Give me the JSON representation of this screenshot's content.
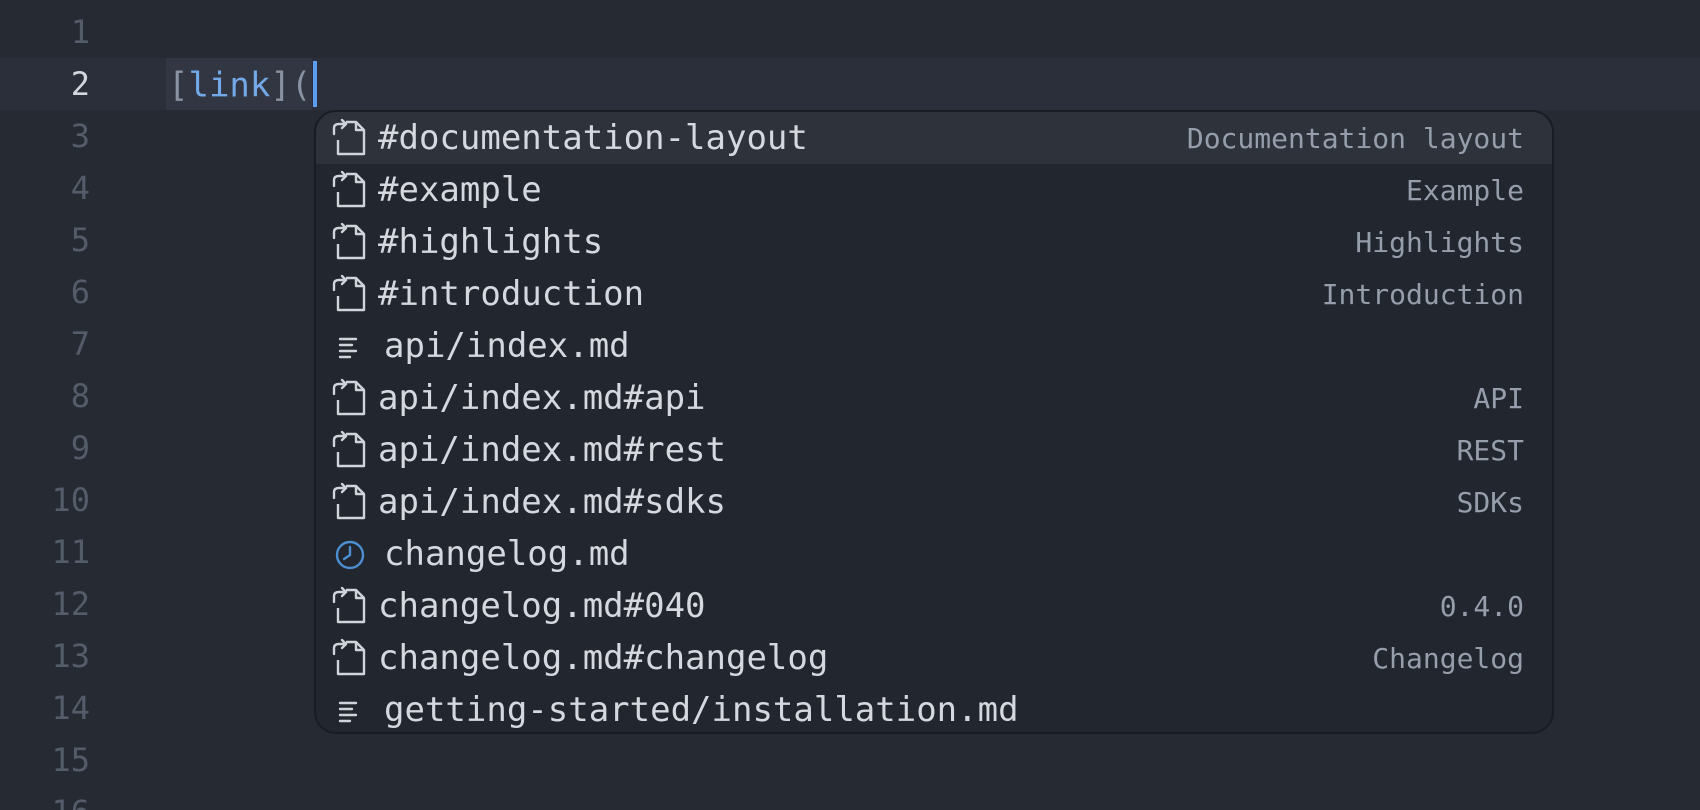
{
  "editor": {
    "line_numbers": [
      "1",
      "2",
      "3",
      "4",
      "5",
      "6",
      "7",
      "8",
      "9",
      "10",
      "11",
      "12",
      "13",
      "14",
      "15",
      "16"
    ],
    "current_line": 2,
    "line2": {
      "open_bracket": "[",
      "link_text": "link",
      "close_bracket": "](",
      "paren": ""
    }
  },
  "completion": {
    "selected_index": 0,
    "items": [
      {
        "label": "#documentation-layout",
        "detail": "Documentation layout",
        "icon": "file-link-icon"
      },
      {
        "label": "#example",
        "detail": "Example",
        "icon": "file-link-icon"
      },
      {
        "label": "#highlights",
        "detail": "Highlights",
        "icon": "file-link-icon"
      },
      {
        "label": "#introduction",
        "detail": "Introduction",
        "icon": "file-link-icon"
      },
      {
        "label": "api/index.md",
        "detail": "",
        "icon": "text-file-icon"
      },
      {
        "label": "api/index.md#api",
        "detail": "API",
        "icon": "file-link-icon"
      },
      {
        "label": "api/index.md#rest",
        "detail": "REST",
        "icon": "file-link-icon"
      },
      {
        "label": "api/index.md#sdks",
        "detail": "SDKs",
        "icon": "file-link-icon"
      },
      {
        "label": "changelog.md",
        "detail": "",
        "icon": "clock-icon"
      },
      {
        "label": "changelog.md#040",
        "detail": "0.4.0",
        "icon": "file-link-icon"
      },
      {
        "label": "changelog.md#changelog",
        "detail": "Changelog",
        "icon": "file-link-icon"
      },
      {
        "label": "getting-started/installation.md",
        "detail": "",
        "icon": "text-file-icon"
      }
    ]
  },
  "colors": {
    "background": "#262a33",
    "current_line": "#2b2f39",
    "popup_background": "#22262e",
    "popup_selected": "#2e323b",
    "link_text": "#73a9e8",
    "cursor": "#5e9bf2",
    "clock_icon": "#4b8fd1"
  }
}
